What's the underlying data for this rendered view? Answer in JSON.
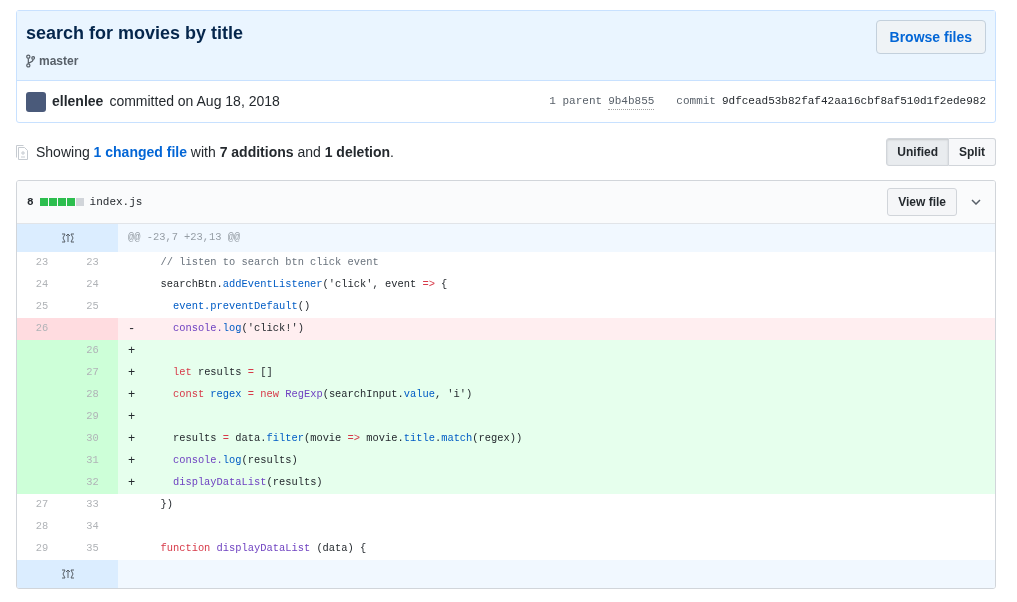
{
  "commit": {
    "title": "search for movies by title",
    "branch": "master",
    "browse_button": "Browse files",
    "author": "ellenlee",
    "committed": "committed on Aug 18, 2018",
    "parents_label": "1 parent",
    "parent_sha": "9b4b855",
    "commit_label": "commit",
    "sha": "9dfcead53b82faf42aa16cbf8af510d1f2ede982"
  },
  "summary": {
    "before": "Showing",
    "link": "1 changed file",
    "after": "with **7 additions** and **1 deletion**."
  },
  "view_toggle": [
    {
      "label": "Unified",
      "selected": true
    },
    {
      "label": "Split",
      "selected": false
    }
  ],
  "file": {
    "changes": "8",
    "diffstat": {
      "level": 0.8
    },
    "name": "index.js",
    "view_button": "View file",
    "expanded": true,
    "rows": [
      {
        "kind": "hunk",
        "text": "@@ -23,7 +23,13 @@"
      },
      {
        "kind": "context",
        "old": "23",
        "new": "23",
        "tokens": [
          {
            "text": "  // listen to search btn click event",
            "kind": "comment"
          }
        ]
      },
      {
        "kind": "context",
        "old": "24",
        "new": "24",
        "tokens": [
          {
            "text": "  searchBtn.",
            "kind": "plain"
          },
          {
            "text": "addEventListener",
            "kind": "property"
          },
          {
            "text": "('click', event ",
            "kind": "plain"
          },
          {
            "text": "=>",
            "kind": "keyword"
          },
          {
            "text": " {",
            "kind": "plain"
          }
        ]
      },
      {
        "kind": "context",
        "old": "25",
        "new": "25",
        "tokens": [
          {
            "text": "    event.",
            "kind": "property"
          },
          {
            "text": "preventDefault",
            "kind": "property"
          },
          {
            "text": "()",
            "kind": "plain"
          }
        ]
      },
      {
        "kind": "deletion",
        "old": "26",
        "marker": "-",
        "tokens": [
          {
            "text": "    console.",
            "kind": "entity"
          },
          {
            "text": "log",
            "kind": "property"
          },
          {
            "text": "('click!')",
            "kind": "plain"
          }
        ]
      },
      {
        "kind": "addition",
        "new": "26",
        "marker": "+",
        "tokens": []
      },
      {
        "kind": "addition",
        "new": "27",
        "marker": "+",
        "tokens": [
          {
            "text": "    let",
            "kind": "keyword"
          },
          {
            "text": " results ",
            "kind": "plain"
          },
          {
            "text": "=",
            "kind": "keyword"
          },
          {
            "text": " []",
            "kind": "plain"
          }
        ]
      },
      {
        "kind": "addition",
        "new": "28",
        "marker": "+",
        "tokens": [
          {
            "text": "    const",
            "kind": "keyword"
          },
          {
            "text": " regex ",
            "kind": "property"
          },
          {
            "text": "=",
            "kind": "keyword"
          },
          {
            "text": " new",
            "kind": "keyword"
          },
          {
            "text": " RegExp",
            "kind": "entity"
          },
          {
            "text": "(searchInput.",
            "kind": "plain"
          },
          {
            "text": "value",
            "kind": "property"
          },
          {
            "text": ", 'i')",
            "kind": "plain"
          }
        ]
      },
      {
        "kind": "addition",
        "new": "29",
        "marker": "+",
        "tokens": []
      },
      {
        "kind": "addition",
        "new": "30",
        "marker": "+",
        "tokens": [
          {
            "text": "    results ",
            "kind": "plain"
          },
          {
            "text": "=",
            "kind": "keyword"
          },
          {
            "text": " data.",
            "kind": "plain"
          },
          {
            "text": "filter",
            "kind": "property"
          },
          {
            "text": "(movie ",
            "kind": "plain"
          },
          {
            "text": "=>",
            "kind": "keyword"
          },
          {
            "text": " movie.",
            "kind": "plain"
          },
          {
            "text": "title",
            "kind": "property"
          },
          {
            "text": ".",
            "kind": "plain"
          },
          {
            "text": "match",
            "kind": "property"
          },
          {
            "text": "(regex))",
            "kind": "plain"
          }
        ]
      },
      {
        "kind": "addition",
        "new": "31",
        "marker": "+",
        "tokens": [
          {
            "text": "    console.",
            "kind": "entity"
          },
          {
            "text": "log",
            "kind": "property"
          },
          {
            "text": "(results)",
            "kind": "plain"
          }
        ]
      },
      {
        "kind": "addition",
        "new": "32",
        "marker": "+",
        "tokens": [
          {
            "text": "    displayDataList",
            "kind": "entity"
          },
          {
            "text": "(results)",
            "kind": "plain"
          }
        ]
      },
      {
        "kind": "context",
        "old": "27",
        "new": "33",
        "tokens": [
          {
            "text": "  })",
            "kind": "plain"
          }
        ]
      },
      {
        "kind": "context",
        "old": "28",
        "new": "34",
        "tokens": []
      },
      {
        "kind": "context",
        "old": "29",
        "new": "35",
        "tokens": [
          {
            "text": "  function",
            "kind": "keyword"
          },
          {
            "text": " displayDataList",
            "kind": "entity"
          },
          {
            "text": " (data) {",
            "kind": "plain"
          }
        ]
      },
      {
        "kind": "expander"
      }
    ]
  }
}
